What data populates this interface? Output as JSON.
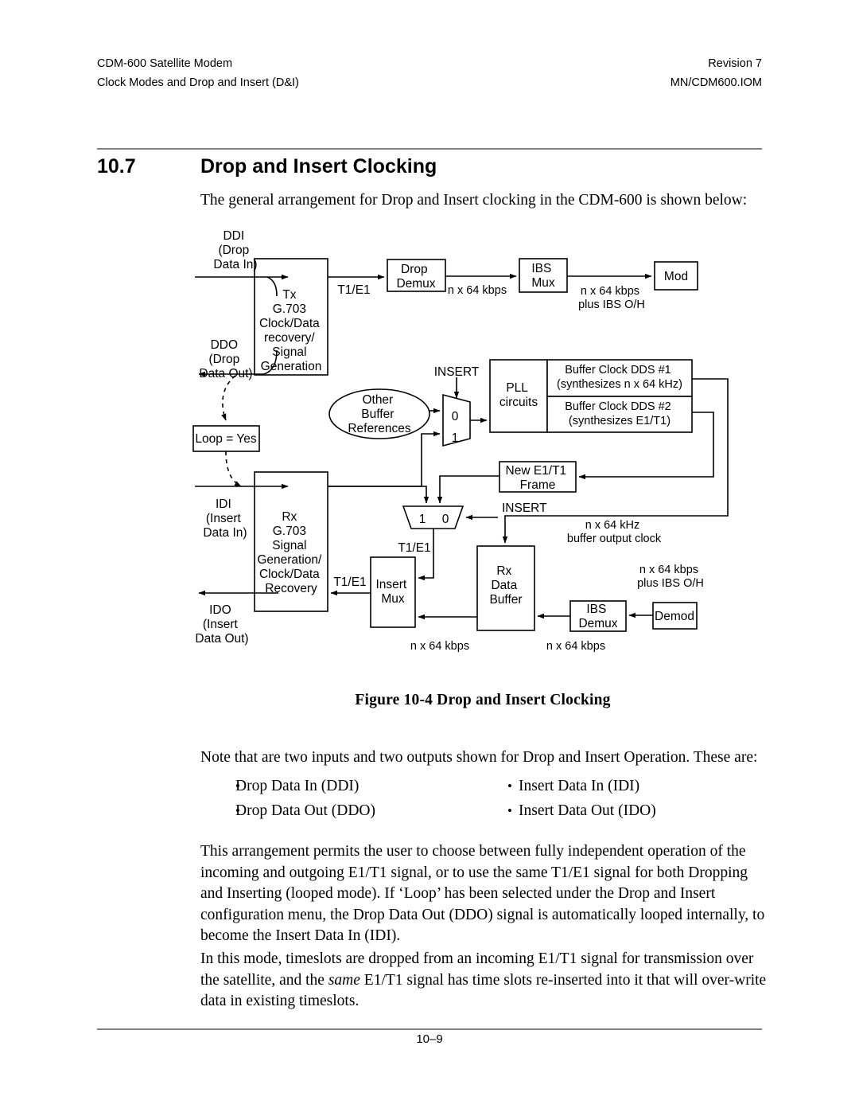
{
  "header": {
    "left_line1": "CDM-600 Satellite Modem",
    "left_line2": "Clock Modes and Drop and Insert (D&I)",
    "right_line1": "Revision  7",
    "right_line2": "MN/CDM600.IOM"
  },
  "section": {
    "number": "10.7",
    "title": "Drop and Insert Clocking",
    "intro": "The general arrangement for Drop and Insert clocking in the CDM-600 is shown below:"
  },
  "figure": {
    "caption": "Figure 10-4  Drop and Insert Clocking",
    "blocks": {
      "tx_g703": "Tx\nG.703\nClock/Data\nrecovery/\nSignal\nGeneration",
      "drop_demux": "Drop\nDemux",
      "ibs_mux": "IBS\nMux",
      "mod": "Mod",
      "pll": "PLL\ncircuits",
      "dds1_line1": "Buffer Clock DDS #1",
      "dds1_line2": "(synthesizes n x 64 kHz)",
      "dds2_line1": "Buffer Clock DDS #2",
      "dds2_line2": "(synthesizes E1/T1)",
      "other_buffer_refs": "Other\nBuffer\nReferences",
      "loop_yes": "Loop = Yes",
      "new_frame": "New E1/T1\nFrame",
      "rx_g703": "Rx\nG.703\nSignal\nGeneration/\nClock/Data\nRecovery",
      "insert_mux": "Insert\nMux",
      "rx_data_buffer": "Rx\nData\nBuffer",
      "ibs_demux": "IBS\nDemux",
      "demod": "Demod"
    },
    "port_labels": {
      "ddi": "DDI\n(Drop\nData In)",
      "ddo": "DDO\n(Drop\nData Out)",
      "idi": "IDI\n(Insert\nData In)",
      "ido": "IDO\n(Insert\nData Out)"
    },
    "signal_labels": {
      "t1e1_top": "T1/E1",
      "nx64_kbps_1": "n x 64 kbps",
      "nx64_plus_ibs_top_l1": "n x 64 kbps",
      "nx64_plus_ibs_top_l2": "plus IBS O/H",
      "insert_upper": "INSERT",
      "insert_lower": "INSERT",
      "mux_upper_0": "0",
      "mux_upper_1": "1",
      "mux_lower_1": "1",
      "mux_lower_0": "0",
      "t1e1_mid": "T1/E1",
      "t1e1_lower_left": "T1/E1",
      "t1e1_lower_mux": "T1/E1",
      "buffer_out_clock_l1": "n x 64 kHz",
      "buffer_out_clock_l2": "buffer output clock",
      "nx64_plus_ibs_bot_l1": "n x 64 kbps",
      "nx64_plus_ibs_bot_l2": "plus IBS O/H",
      "nx64_kbps_insertmux": "n x 64 kbps",
      "nx64_kbps_ibsdemux": "n x 64 kbps"
    }
  },
  "body": {
    "note": "Note that are two inputs and two outputs shown for Drop and Insert Operation. These are:",
    "bullets_left": [
      "Drop Data In (DDI)",
      "Drop Data Out (DDO)"
    ],
    "bullets_right": [
      "Insert Data In (IDI)",
      "Insert Data Out (IDO)"
    ],
    "bullet_glyph": "•",
    "paragraph1": "This arrangement permits the user to choose between fully independent operation of the incoming and outgoing E1/T1 signal, or to use the same T1/E1 signal for both Dropping and Inserting (looped mode). If ‘Loop’ has been selected under the Drop and Insert configuration menu, the Drop Data Out (DDO) signal is automatically looped internally, to become the Insert Data In (IDI).",
    "paragraph2_part1": "In this mode, timeslots are dropped from an incoming E1/T1 signal for transmission over the satellite, and the ",
    "paragraph2_em": "same",
    "paragraph2_part2": " E1/T1 signal has time slots re-inserted into it that will over-write data in existing timeslots."
  },
  "footer": {
    "page_number": "10–9"
  },
  "colors": {
    "ink": "#000000",
    "rule": "#808080",
    "paper": "#ffffff"
  }
}
